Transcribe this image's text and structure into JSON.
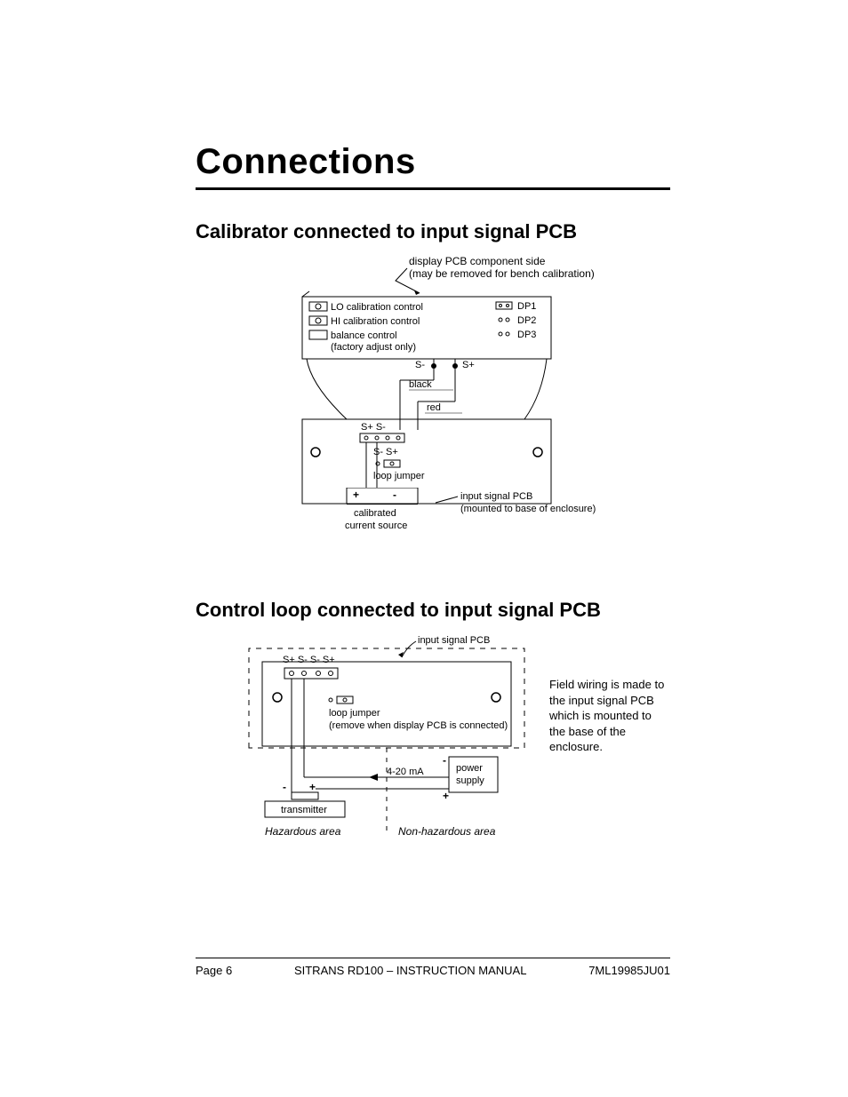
{
  "title": "Connections",
  "section1": {
    "heading": "Calibrator connected to input signal PCB",
    "displayPcbLine1": "display PCB component side",
    "displayPcbLine2": "(may be removed for bench calibration)",
    "loCal": "LO calibration control",
    "hiCal": "HI calibration control",
    "balCtrl": "balance control",
    "balNote": "(factory adjust only)",
    "dp1": "DP1",
    "dp2": "DP2",
    "dp3": "DP3",
    "sMinus": "S-",
    "sPlus": "S+",
    "black": "black",
    "red": "red",
    "sPlusSMinusLeft": "S+ S-",
    "sMinusSPlusMid": "S-  S+",
    "loopJumper": "loop jumper",
    "plus": "+",
    "minus": "-",
    "calibSrc1": "calibrated",
    "calibSrc2": "current source",
    "inputPcb": "input signal PCB",
    "inputPcbNote": "(mounted to base of enclosure)"
  },
  "section2": {
    "heading": "Control loop connected to input signal PCB",
    "inputPcb": "input signal PCB",
    "terminals": "S+  S-  S-   S+",
    "loopJumper": "loop jumper",
    "loopJumperNote": "(remove when display PCB is connected)",
    "signal": "4-20 mA",
    "powerSupply1": "power",
    "powerSupply2": "supply",
    "transmitter": "transmitter",
    "haz": "Hazardous area",
    "nonhaz": "Non-hazardous area",
    "sideText": "Field wiring is made to the input signal PCB which is mounted to the base of the enclosure.",
    "plus": "+",
    "minus": "-"
  },
  "footer": {
    "pageLabel": "Page 6",
    "center": "SITRANS RD100 – INSTRUCTION MANUAL",
    "right": "7ML19985JU01"
  }
}
